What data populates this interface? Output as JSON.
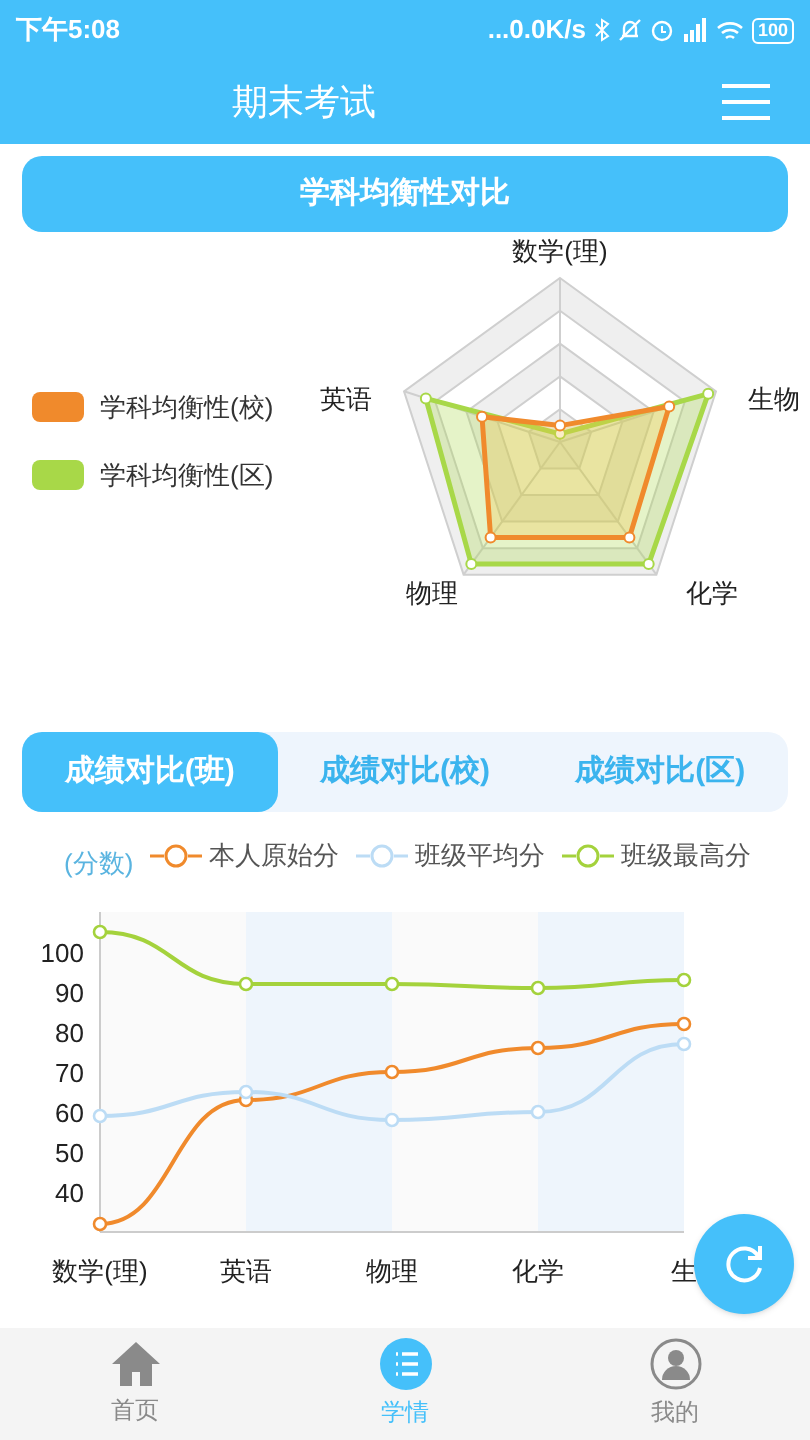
{
  "status_bar": {
    "time": "下午5:08",
    "speed": "...0.0K/s",
    "battery": "100"
  },
  "header": {
    "title": "期末考试"
  },
  "balance": {
    "title": "学科均衡性对比",
    "legend": [
      {
        "label": "学科均衡性(校)",
        "color": "#f08a2c"
      },
      {
        "label": "学科均衡性(区)",
        "color": "#a8d848"
      }
    ],
    "axes": [
      "数学(理)",
      "生物",
      "化学",
      "物理",
      "英语"
    ]
  },
  "tabs": [
    {
      "label": "成绩对比(班)",
      "selected": true
    },
    {
      "label": "成绩对比(校)",
      "selected": false
    },
    {
      "label": "成绩对比(区)",
      "selected": false
    }
  ],
  "chart_data": {
    "type": "line",
    "ylabel": "(分数)",
    "categories": [
      "数学(理)",
      "英语",
      "物理",
      "化学",
      "生"
    ],
    "ylim": [
      30,
      110
    ],
    "yticks": [
      40,
      50,
      60,
      70,
      80,
      90,
      100
    ],
    "series": [
      {
        "name": "本人原始分",
        "color": "#f08a2c",
        "marker": "circle",
        "values": [
          32,
          63,
          70,
          76,
          82
        ]
      },
      {
        "name": "班级平均分",
        "color": "#bcdcf5",
        "marker": "circle",
        "values": [
          59,
          65,
          58,
          60,
          77
        ]
      },
      {
        "name": "班级最高分",
        "color": "#a4d23c",
        "marker": "circle",
        "values": [
          105,
          92,
          92,
          91,
          93
        ]
      }
    ]
  },
  "nav": [
    {
      "label": "首页",
      "kind": "home",
      "selected": false
    },
    {
      "label": "学情",
      "kind": "list",
      "selected": true
    },
    {
      "label": "我的",
      "kind": "person",
      "selected": false
    }
  ]
}
